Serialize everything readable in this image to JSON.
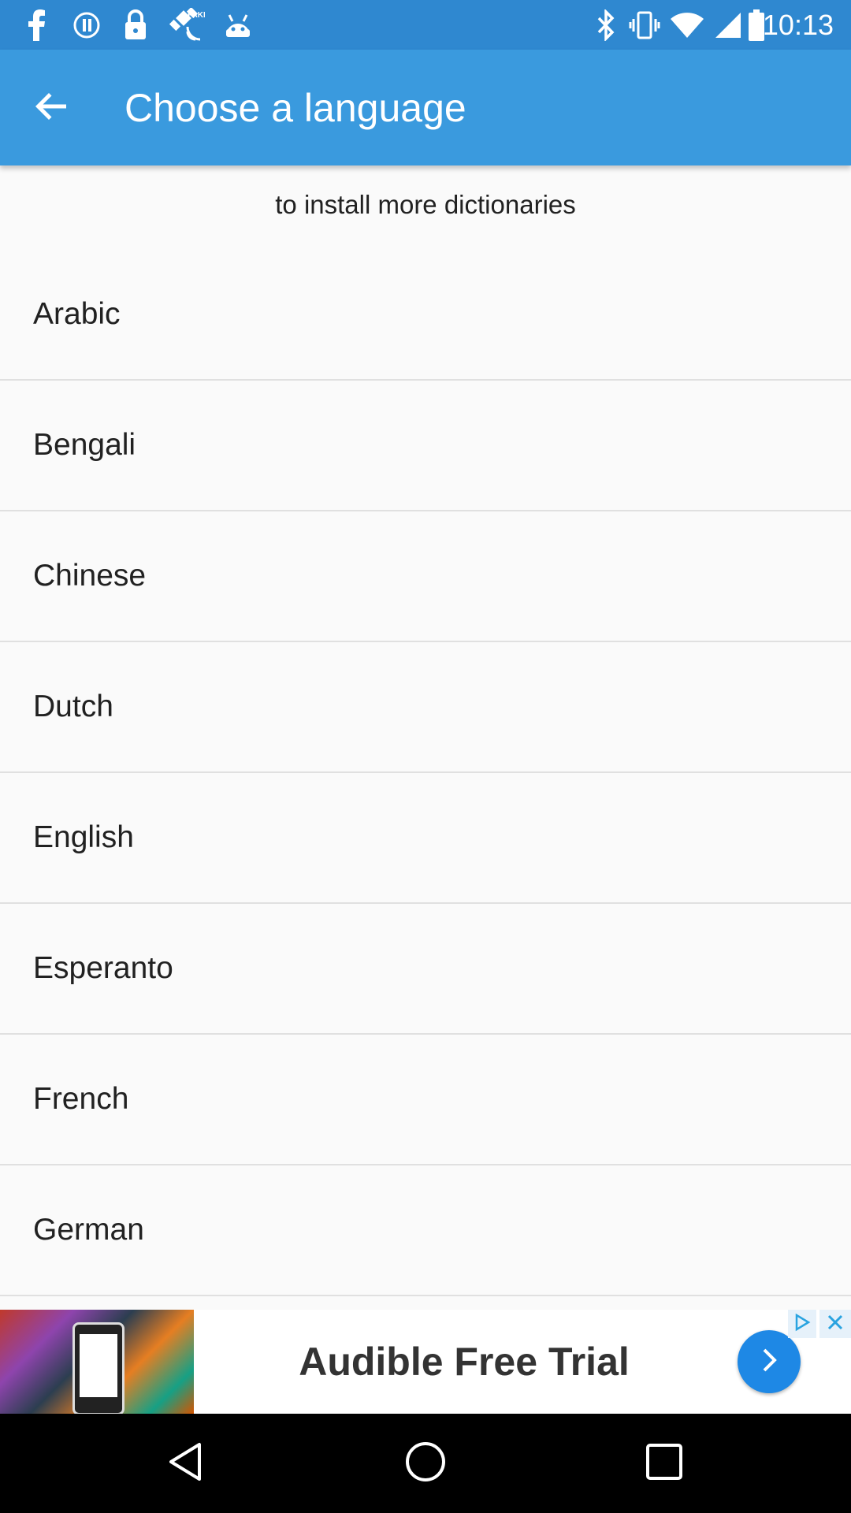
{
  "status_bar": {
    "time": "10:13",
    "icons": [
      "facebook-icon",
      "messenger-icon",
      "lock-icon",
      "fake-gps-icon",
      "android-icon",
      "bluetooth-icon",
      "vibrate-icon",
      "wifi-icon",
      "signal-icon",
      "battery-icon"
    ]
  },
  "app_bar": {
    "title": "Choose a language",
    "back_icon": "arrow-back-icon"
  },
  "hint": "to install more dictionaries",
  "languages": [
    "Arabic",
    "Bengali",
    "Chinese",
    "Dutch",
    "English",
    "Esperanto",
    "French",
    "German"
  ],
  "ad": {
    "text": "Audible Free Trial",
    "arrow_icon": "chevron-right-icon",
    "choices_icon": "ad-choices-icon",
    "close_icon": "close-icon"
  },
  "nav_bar": {
    "icons": [
      "back-triangle-icon",
      "home-circle-icon",
      "recents-square-icon"
    ]
  },
  "colors": {
    "status_bar": "#2f88d0",
    "app_bar": "#3a9ade",
    "background": "#fafafa",
    "divider": "#e0e0e0",
    "ad_button": "#1e88e5"
  }
}
